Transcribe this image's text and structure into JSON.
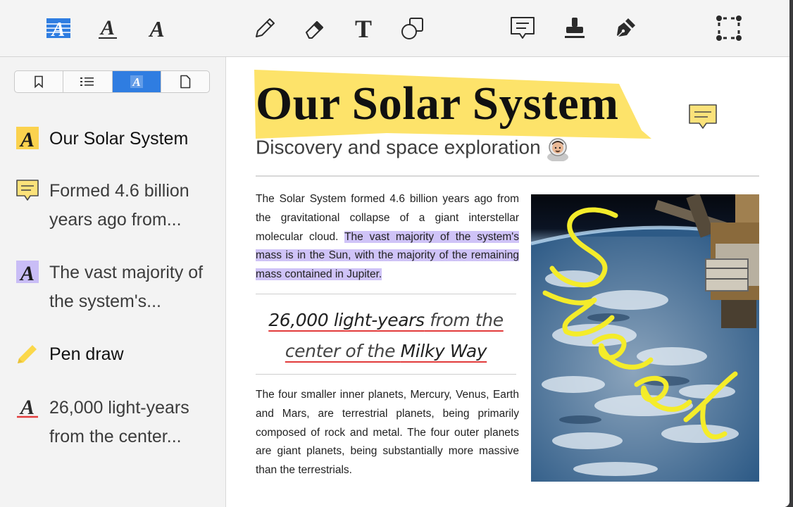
{
  "toolbar": {
    "tools": [
      {
        "name": "text-highlight-tool-icon",
        "active": true
      },
      {
        "name": "text-underline-tool-icon"
      },
      {
        "name": "text-strikethrough-tool-icon"
      },
      {
        "name": "pencil-tool-icon"
      },
      {
        "name": "eraser-tool-icon"
      },
      {
        "name": "text-tool-icon"
      },
      {
        "name": "shapes-tool-icon"
      },
      {
        "name": "note-tool-icon"
      },
      {
        "name": "stamp-tool-icon"
      },
      {
        "name": "signature-pen-tool-icon"
      },
      {
        "name": "selection-tool-icon"
      }
    ],
    "accent": "#2f7de1"
  },
  "sidebar": {
    "tabs": [
      "bookmark-icon",
      "list-icon",
      "annotations-icon",
      "page-icon"
    ],
    "active_tab": 2,
    "annotations": [
      {
        "icon": "yellow-highlight-icon",
        "text": "Our Solar System"
      },
      {
        "icon": "note-icon",
        "text": "Formed 4.6 billion years ago from..."
      },
      {
        "icon": "purple-highlight-icon",
        "text": "The vast majority of the system's..."
      },
      {
        "icon": "pencil-icon",
        "text": "Pen draw"
      },
      {
        "icon": "underline-icon",
        "text": "26,000 light-years from the center..."
      }
    ]
  },
  "document": {
    "title": "Our Solar System",
    "subtitle": "Discovery and space exploration",
    "paragraph1_plain": "The Solar System formed 4.6 billion years ago from the gravitational collapse of a giant interstellar molecular cloud. ",
    "paragraph1_highlight": "The vast majority of the system's mass is in the Sun, with the majority of the remaining mass contained in Jupiter.",
    "quote_part1": "26,000 light-years",
    "quote_part2": " from the",
    "quote_part3": "center of the ",
    "quote_part4": "Milky Way",
    "paragraph2": "The four smaller inner planets, Mercury, Venus, Earth and Mars, are terrestrial planets, being primarily composed of rock and metal. The four outer planets are giant planets, being substantially more massive than the terrestrials.",
    "handwriting": "Sweet",
    "colors": {
      "title_highlight": "#fde36a",
      "text_highlight": "#cfc3f7",
      "underline": "#e23c3c",
      "ink": "#f4ec2a"
    }
  }
}
